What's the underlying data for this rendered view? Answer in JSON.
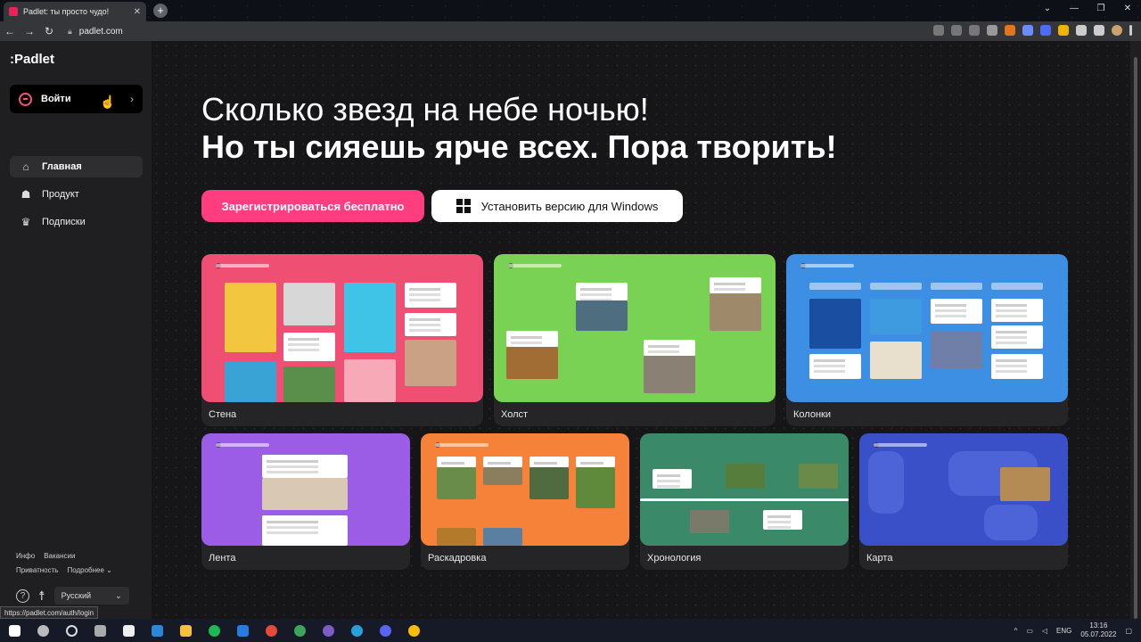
{
  "browser": {
    "tab_title": "Padlet: ты просто чудо!",
    "tab_close": "✕",
    "new_tab": "+",
    "url": "padlet.com",
    "window_controls": [
      "⌄",
      "—",
      "❐",
      "✕"
    ]
  },
  "sidebar": {
    "logo": ":Padlet",
    "login_label": "Войти",
    "login_chevron": "›",
    "nav": [
      {
        "label": "Главная",
        "icon": "home-icon"
      },
      {
        "label": "Продукт",
        "icon": "product-icon"
      },
      {
        "label": "Подписки",
        "icon": "crown-icon"
      }
    ],
    "footer_links_row1": [
      "Инфо",
      "Вакансии"
    ],
    "footer_links_row2": [
      "Приватность",
      "Подробнее ⌄"
    ],
    "help": "?",
    "language": "Русский",
    "language_chevron": "⌄"
  },
  "status_url": "https://padlet.com/auth/login",
  "hero": {
    "line1": "Сколько звезд на небе ночью!",
    "line2": "Но ты сияешь ярче всех. Пора творить!",
    "signup_button": "Зарегистрироваться бесплатно",
    "windows_button": "Установить версию для Windows"
  },
  "cards": [
    {
      "caption": "Стена",
      "color": "#ef4f72"
    },
    {
      "caption": "Холст",
      "color": "#7ad254"
    },
    {
      "caption": "Колонки",
      "color": "#3c8fe3"
    },
    {
      "caption": "Лента",
      "color": "#9b5de5"
    },
    {
      "caption": "Раскадровка",
      "color": "#f6823a"
    },
    {
      "caption": "Хронология",
      "color": "#3a8a6a"
    },
    {
      "caption": "Карта",
      "color": "#3a50c8"
    }
  ],
  "taskbar": {
    "lang": "ENG",
    "time": "13:16",
    "date": "05.07.2022"
  }
}
